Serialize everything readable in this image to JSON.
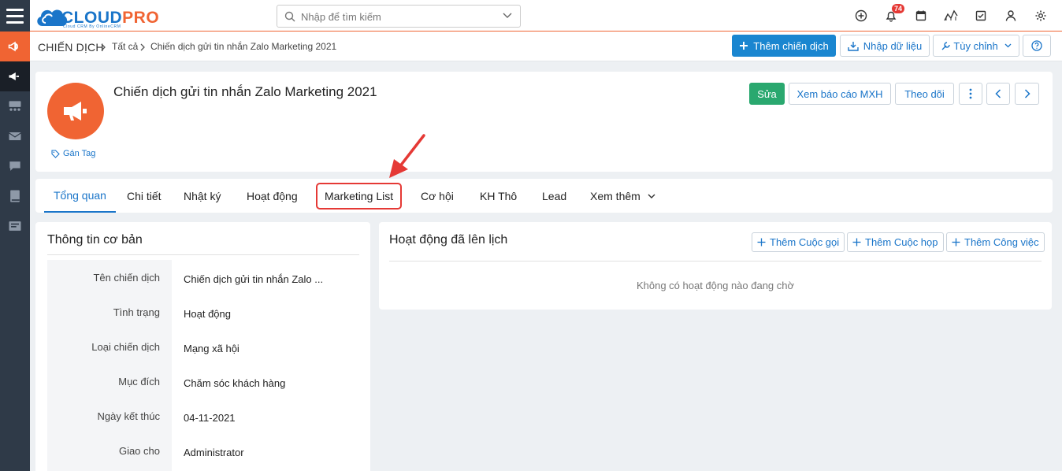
{
  "header": {
    "logo_main_a": "CLOUD",
    "logo_main_b": "PRO",
    "logo_sub": "Cloud CRM By OnlineCRM",
    "search_placeholder": "Nhập để tìm kiếm",
    "notification_count": "74",
    "icons": [
      "plus-circle-icon",
      "bell-icon",
      "calendar-icon",
      "chart-icon",
      "checkbox-icon",
      "user-icon",
      "gear-icon"
    ]
  },
  "breadcrumb": {
    "module": "CHIẾN DỊCH",
    "level1": "Tất cả",
    "level2": "Chiến dịch gửi tin nhắn Zalo Marketing 2021"
  },
  "toolbar": {
    "add_label": "Thêm chiến dịch",
    "import_label": "Nhập dữ liệu",
    "customize_label": "Tùy chỉnh"
  },
  "record": {
    "title": "Chiến dịch gửi tin nhắn Zalo Marketing 2021",
    "tag_label": "Gán Tag",
    "edit_label": "Sửa",
    "report_label": "Xem báo cáo MXH",
    "follow_label": "Theo dõi"
  },
  "tabs": [
    {
      "label": "Tổng quan"
    },
    {
      "label": "Chi tiết"
    },
    {
      "label": "Nhật ký"
    },
    {
      "label": "Hoạt động"
    },
    {
      "label": "Marketing List"
    },
    {
      "label": "Cơ hội"
    },
    {
      "label": "KH Thô"
    },
    {
      "label": "Lead"
    },
    {
      "label": "Xem thêm"
    }
  ],
  "basic_info": {
    "title": "Thông tin cơ bản",
    "rows": [
      {
        "label": "Tên chiến dịch",
        "value": "Chiến dịch gửi tin nhắn Zalo ..."
      },
      {
        "label": "Tình trạng",
        "value": "Hoạt động"
      },
      {
        "label": "Loại chiến dịch",
        "value": "Mạng xã hội"
      },
      {
        "label": "Mục đích",
        "value": "Chăm sóc khách hàng"
      },
      {
        "label": "Ngày kết thúc",
        "value": "04-11-2021"
      },
      {
        "label": "Giao cho",
        "value": "Administrator"
      }
    ]
  },
  "activities": {
    "title": "Hoạt động đã lên lịch",
    "add_call": "Thêm Cuộc gọi",
    "add_meeting": "Thêm Cuộc họp",
    "add_task": "Thêm Công việc",
    "empty_text": "Không có hoạt động nào đang chờ"
  },
  "colors": {
    "accent": "#1a86d0",
    "brand_orange": "#f06433",
    "success": "#2aa86f",
    "highlight": "#e53935"
  }
}
